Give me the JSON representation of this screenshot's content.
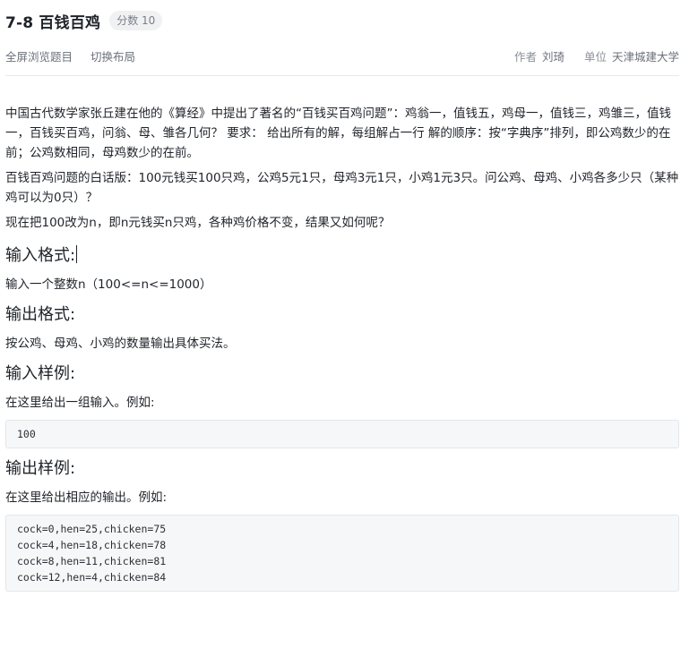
{
  "header": {
    "title": "7-8 百钱百鸡",
    "score": "分数 10"
  },
  "toolbar": {
    "fullscreen_label": "全屏浏览题目",
    "switch_layout_label": "切换布局",
    "author_key": "作者",
    "author_value": "刘琦",
    "unit_key": "单位",
    "unit_value": "天津城建大学"
  },
  "problem": {
    "para1": "中国古代数学家张丘建在他的《算经》中提出了著名的“百钱买百鸡问题”：鸡翁一，值钱五，鸡母一，值钱三，鸡雏三，值钱一，百钱买百鸡，问翁、母、雏各几何？ 要求： 给出所有的解，每组解占一行 解的顺序：按“字典序”排列，即公鸡数少的在前；公鸡数相同，母鸡数少的在前。",
    "para2": "百钱百鸡问题的白话版：100元钱买100只鸡，公鸡5元1只，母鸡3元1只，小鸡1元3只。问公鸡、母鸡、小鸡各多少只（某种鸡可以为0只）？",
    "para3": "现在把100改为n，即n元钱买n只鸡，各种鸡价格不变，结果又如何呢？",
    "input_format_heading": "输入格式:",
    "input_format_text": "输入一个整数n（100<=n<=1000）",
    "output_format_heading": "输出格式:",
    "output_format_text": "按公鸡、母鸡、小鸡的数量输出具体买法。",
    "sample_input_heading": "输入样例:",
    "sample_input_intro": "在这里给出一组输入。例如:",
    "sample_input_code": "100",
    "sample_output_heading": "输出样例:",
    "sample_output_intro": "在这里给出相应的输出。例如:",
    "sample_output_code": "cock=0,hen=25,chicken=75\ncock=4,hen=18,chicken=78\ncock=8,hen=11,chicken=81\ncock=12,hen=4,chicken=84"
  }
}
